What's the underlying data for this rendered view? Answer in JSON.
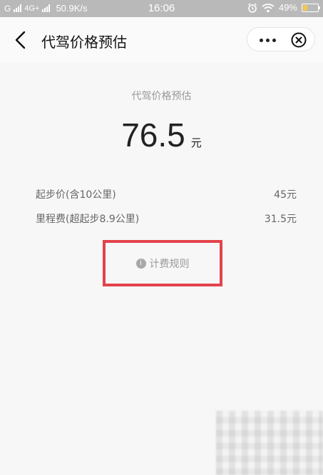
{
  "status_bar": {
    "carrier": "G",
    "network": "4G+",
    "speed": "50.9K/s",
    "time": "16:06",
    "battery": "49%"
  },
  "nav": {
    "title": "代驾价格预估"
  },
  "estimate": {
    "label": "代驾价格预估",
    "price": "76.5",
    "unit": "元"
  },
  "breakdown": [
    {
      "label": "起步价(含10公里)",
      "value": "45元"
    },
    {
      "label": "里程费(超起步8.9公里)",
      "value": "31.5元"
    }
  ],
  "rule": {
    "icon_char": "i",
    "label": "计费规则"
  },
  "colors": {
    "highlight": "#e2434b"
  }
}
